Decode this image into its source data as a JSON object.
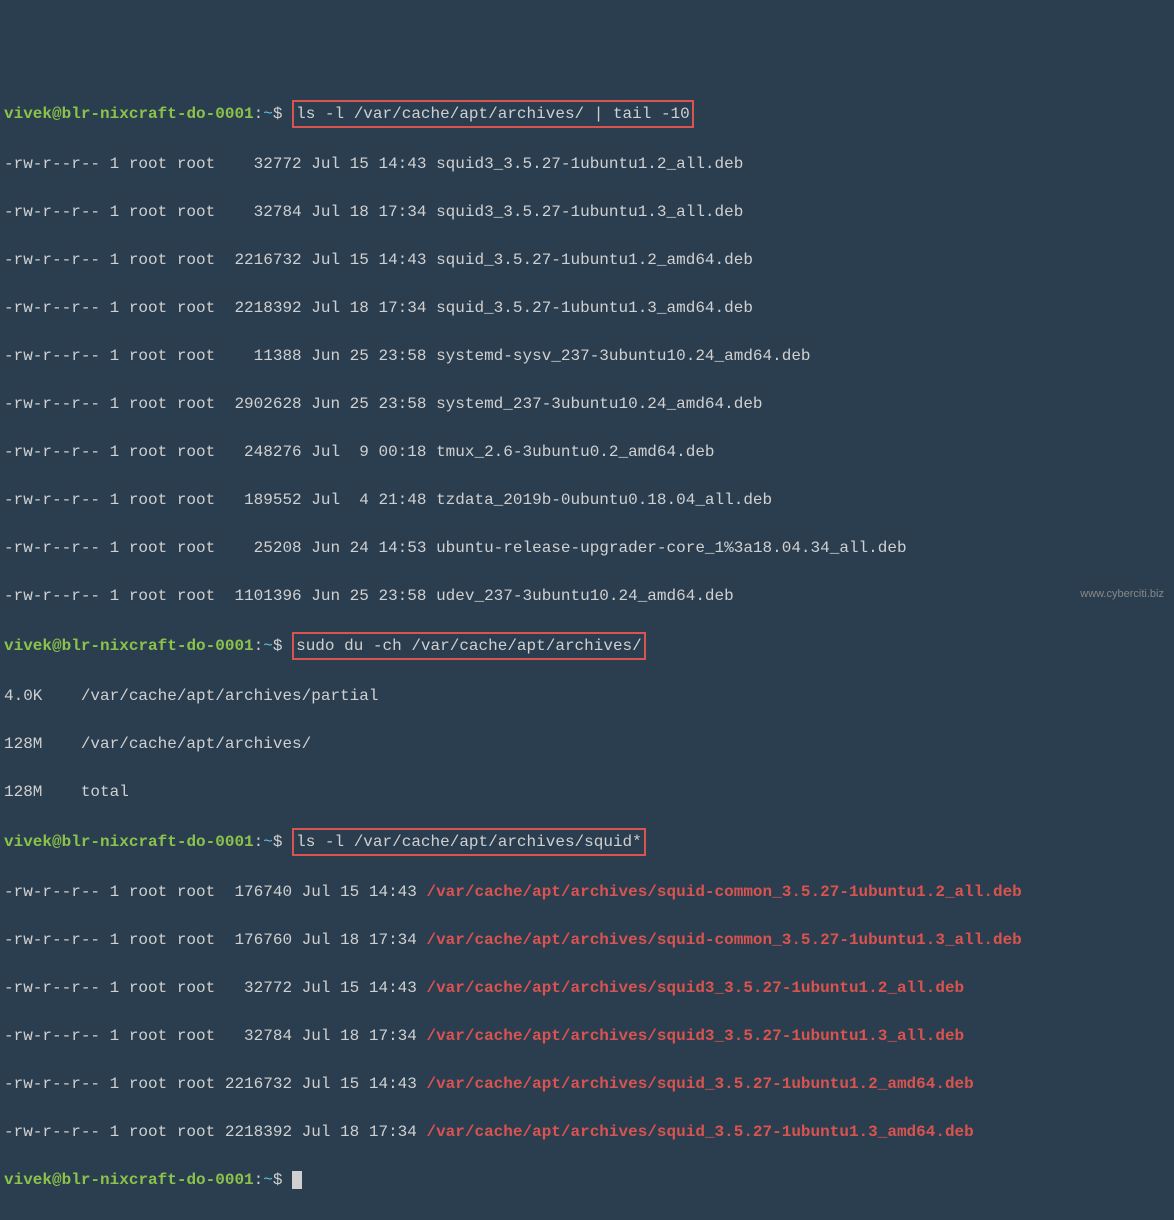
{
  "prompt": {
    "user": "vivek",
    "at": "@",
    "host": "blr-nixcraft-do-0001",
    "colon": ":",
    "path": "~",
    "dollar": "$"
  },
  "cmd1": "ls -l /var/cache/apt/archives/ | tail -10",
  "cmd2": "sudo du -ch /var/cache/apt/archives/",
  "cmd3": "ls -l /var/cache/apt/archives/squid*",
  "out1": {
    "l0": "-rw-r--r-- 1 root root    32772 Jul 15 14:43 squid3_3.5.27-1ubuntu1.2_all.deb",
    "l1": "-rw-r--r-- 1 root root    32784 Jul 18 17:34 squid3_3.5.27-1ubuntu1.3_all.deb",
    "l2": "-rw-r--r-- 1 root root  2216732 Jul 15 14:43 squid_3.5.27-1ubuntu1.2_amd64.deb",
    "l3": "-rw-r--r-- 1 root root  2218392 Jul 18 17:34 squid_3.5.27-1ubuntu1.3_amd64.deb",
    "l4": "-rw-r--r-- 1 root root    11388 Jun 25 23:58 systemd-sysv_237-3ubuntu10.24_amd64.deb",
    "l5": "-rw-r--r-- 1 root root  2902628 Jun 25 23:58 systemd_237-3ubuntu10.24_amd64.deb",
    "l6": "-rw-r--r-- 1 root root   248276 Jul  9 00:18 tmux_2.6-3ubuntu0.2_amd64.deb",
    "l7": "-rw-r--r-- 1 root root   189552 Jul  4 21:48 tzdata_2019b-0ubuntu0.18.04_all.deb",
    "l8": "-rw-r--r-- 1 root root    25208 Jun 24 14:53 ubuntu-release-upgrader-core_1%3a18.04.34_all.deb",
    "l9": "-rw-r--r-- 1 root root  1101396 Jun 25 23:58 udev_237-3ubuntu10.24_amd64.deb"
  },
  "out2": {
    "l0": "4.0K    /var/cache/apt/archives/partial",
    "l1": "128M    /var/cache/apt/archives/",
    "l2": "128M    total"
  },
  "out3": {
    "rows": [
      {
        "prefix": "-rw-r--r-- 1 root root  176740 Jul 15 14:43 ",
        "path": "/var/cache/apt/archives/squid-common_3.5.27-1ubuntu1.2_all.deb"
      },
      {
        "prefix": "-rw-r--r-- 1 root root  176760 Jul 18 17:34 ",
        "path": "/var/cache/apt/archives/squid-common_3.5.27-1ubuntu1.3_all.deb"
      },
      {
        "prefix": "-rw-r--r-- 1 root root   32772 Jul 15 14:43 ",
        "path": "/var/cache/apt/archives/squid3_3.5.27-1ubuntu1.2_all.deb"
      },
      {
        "prefix": "-rw-r--r-- 1 root root   32784 Jul 18 17:34 ",
        "path": "/var/cache/apt/archives/squid3_3.5.27-1ubuntu1.3_all.deb"
      },
      {
        "prefix": "-rw-r--r-- 1 root root 2216732 Jul 15 14:43 ",
        "path": "/var/cache/apt/archives/squid_3.5.27-1ubuntu1.2_amd64.deb"
      },
      {
        "prefix": "-rw-r--r-- 1 root root 2218392 Jul 18 17:34 ",
        "path": "/var/cache/apt/archives/squid_3.5.27-1ubuntu1.3_amd64.deb"
      }
    ]
  },
  "watermark": "www.cyberciti.biz"
}
